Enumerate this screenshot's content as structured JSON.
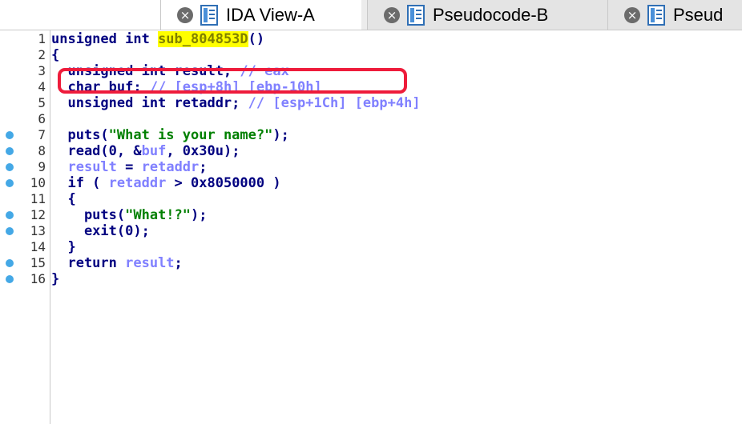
{
  "tabs": [
    {
      "label": "IDA View-A",
      "state": "active"
    },
    {
      "label": "Pseudocode-B",
      "state": "inactive"
    },
    {
      "label": "Pseud",
      "state": "inactive"
    }
  ],
  "code": {
    "lines": [
      {
        "n": "1",
        "dot": false,
        "tokens": [
          {
            "t": "unsigned int ",
            "c": "kw"
          },
          {
            "t": "sub_804853D",
            "c": "hl"
          },
          {
            "t": "()",
            "c": "kw"
          }
        ]
      },
      {
        "n": "2",
        "dot": false,
        "tokens": [
          {
            "t": "{",
            "c": "kw"
          }
        ]
      },
      {
        "n": "3",
        "dot": false,
        "tokens": [
          {
            "t": "  unsigned int result; ",
            "c": "kw"
          },
          {
            "t": "// eax",
            "c": "cmt"
          }
        ]
      },
      {
        "n": "4",
        "dot": false,
        "tokens": [
          {
            "t": "  char buf; ",
            "c": "kw"
          },
          {
            "t": "// [esp+8h] [ebp-10h]",
            "c": "cmt"
          }
        ]
      },
      {
        "n": "5",
        "dot": false,
        "tokens": [
          {
            "t": "  unsigned int retaddr; ",
            "c": "kw"
          },
          {
            "t": "// [esp+1Ch] [ebp+4h]",
            "c": "cmt"
          }
        ]
      },
      {
        "n": "6",
        "dot": false,
        "tokens": []
      },
      {
        "n": "7",
        "dot": true,
        "tokens": [
          {
            "t": "  puts(",
            "c": "kw"
          },
          {
            "t": "\"What is your name?\"",
            "c": "str"
          },
          {
            "t": ");",
            "c": "kw"
          }
        ]
      },
      {
        "n": "8",
        "dot": true,
        "tokens": [
          {
            "t": "  read(0, &",
            "c": "kw"
          },
          {
            "t": "buf",
            "c": "var"
          },
          {
            "t": ", 0x30u);",
            "c": "kw"
          }
        ]
      },
      {
        "n": "9",
        "dot": true,
        "tokens": [
          {
            "t": "  ",
            "c": "kw"
          },
          {
            "t": "result",
            "c": "var"
          },
          {
            "t": " = ",
            "c": "kw"
          },
          {
            "t": "retaddr",
            "c": "var"
          },
          {
            "t": ";",
            "c": "kw"
          }
        ]
      },
      {
        "n": "10",
        "dot": true,
        "tokens": [
          {
            "t": "  if ( ",
            "c": "kw"
          },
          {
            "t": "retaddr",
            "c": "var"
          },
          {
            "t": " > 0x8050000 )",
            "c": "kw"
          }
        ]
      },
      {
        "n": "11",
        "dot": false,
        "tokens": [
          {
            "t": "  {",
            "c": "kw"
          }
        ]
      },
      {
        "n": "12",
        "dot": true,
        "tokens": [
          {
            "t": "    puts(",
            "c": "kw"
          },
          {
            "t": "\"What!?\"",
            "c": "str"
          },
          {
            "t": ");",
            "c": "kw"
          }
        ]
      },
      {
        "n": "13",
        "dot": true,
        "tokens": [
          {
            "t": "    exit(0);",
            "c": "kw"
          }
        ]
      },
      {
        "n": "14",
        "dot": false,
        "tokens": [
          {
            "t": "  }",
            "c": "kw"
          }
        ]
      },
      {
        "n": "15",
        "dot": true,
        "tokens": [
          {
            "t": "  return ",
            "c": "kw"
          },
          {
            "t": "result",
            "c": "var"
          },
          {
            "t": ";",
            "c": "kw"
          }
        ]
      },
      {
        "n": "16",
        "dot": true,
        "tokens": [
          {
            "t": "}",
            "c": "kw"
          }
        ]
      }
    ]
  },
  "colors": {
    "keyword": "#000080",
    "variable": "#8080ff",
    "comment": "#8080ff",
    "string": "#008000",
    "highlight": "#ffff00",
    "breakpoint_dot": "#44a8e6",
    "annotation": "#ee1c3b"
  }
}
